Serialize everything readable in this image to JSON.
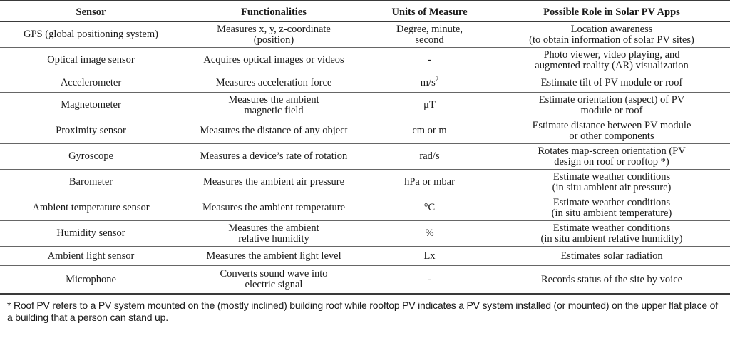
{
  "table": {
    "headers": [
      "Sensor",
      "Functionalities",
      "Units of Measure",
      "Possible Role in Solar PV Apps"
    ],
    "rows": [
      {
        "sensor": [
          "GPS (global positioning system)"
        ],
        "function": [
          "Measures x, y, z-coordinate",
          "(position)"
        ],
        "unit": [
          "Degree, minute,",
          "second"
        ],
        "role": [
          "Location awareness",
          "(to obtain information of solar PV sites)"
        ]
      },
      {
        "sensor": [
          "Optical image sensor"
        ],
        "function": [
          "Acquires optical images or videos"
        ],
        "unit": [
          "-"
        ],
        "role": [
          "Photo viewer, video playing, and",
          "augmented reality (AR) visualization"
        ]
      },
      {
        "sensor": [
          "Accelerometer"
        ],
        "function": [
          "Measures acceleration force"
        ],
        "unit": [
          "m/s"
        ],
        "unit_sup": "2",
        "role": [
          "Estimate tilt of PV module or roof"
        ]
      },
      {
        "sensor": [
          "Magnetometer"
        ],
        "function": [
          "Measures the ambient",
          "magnetic field"
        ],
        "unit": [
          "μT"
        ],
        "role": [
          "Estimate orientation (aspect) of PV",
          "module or roof"
        ]
      },
      {
        "sensor": [
          "Proximity sensor"
        ],
        "function": [
          "Measures the distance of any object"
        ],
        "unit": [
          "cm or m"
        ],
        "role": [
          "Estimate distance between PV module",
          "or other components"
        ]
      },
      {
        "sensor": [
          "Gyroscope"
        ],
        "function": [
          "Measures a device’s rate of rotation"
        ],
        "unit": [
          "rad/s"
        ],
        "role": [
          "Rotates map-screen orientation (PV",
          "design on roof or rooftop *)"
        ]
      },
      {
        "sensor": [
          "Barometer"
        ],
        "function": [
          "Measures the ambient air pressure"
        ],
        "unit": [
          "hPa or mbar"
        ],
        "role": [
          "Estimate weather conditions",
          "(in situ ambient air pressure)"
        ]
      },
      {
        "sensor": [
          "Ambient temperature sensor"
        ],
        "function": [
          "Measures the ambient temperature"
        ],
        "unit": [
          "°C"
        ],
        "role": [
          "Estimate weather conditions",
          "(in situ ambient temperature)"
        ]
      },
      {
        "sensor": [
          "Humidity sensor"
        ],
        "function": [
          "Measures the ambient",
          "relative humidity"
        ],
        "unit": [
          "%"
        ],
        "role": [
          "Estimate weather conditions",
          "(in situ ambient relative humidity)"
        ]
      },
      {
        "sensor": [
          "Ambient light sensor"
        ],
        "function": [
          "Measures the ambient light level"
        ],
        "unit": [
          "Lx"
        ],
        "role": [
          "Estimates solar radiation"
        ]
      },
      {
        "sensor": [
          "Microphone"
        ],
        "function": [
          "Converts sound wave into",
          "electric signal"
        ],
        "unit": [
          "-"
        ],
        "role": [
          "Records status of the site by voice"
        ]
      }
    ]
  },
  "footnote": "* Roof PV refers to a PV system mounted on the (mostly inclined) building roof while rooftop PV indicates a PV system installed (or mounted) on the upper flat place of a building that a person can stand up."
}
